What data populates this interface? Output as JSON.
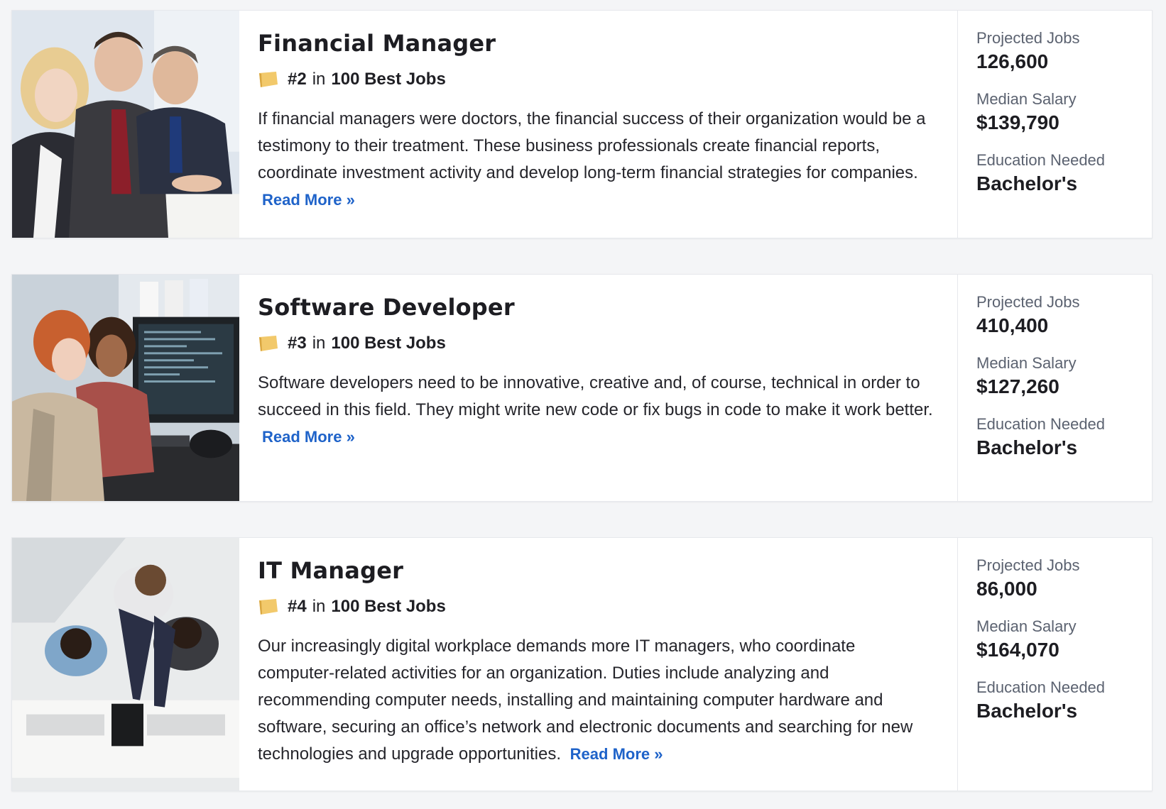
{
  "jobs": [
    {
      "title": "Financial Manager",
      "rank": "#2",
      "rank_in": "in",
      "rank_list": "100 Best Jobs",
      "description": "If financial managers were doctors, the financial success of their organization would be a testimony to their treatment. These business professionals create financial reports, coordinate investment activity and develop long-term financial strategies for companies.",
      "read_more": "Read More »",
      "stats": {
        "projected_jobs_label": "Projected Jobs",
        "projected_jobs": "126,600",
        "median_salary_label": "Median Salary",
        "median_salary": "$139,790",
        "education_label": "Education Needed",
        "education": "Bachelor's"
      }
    },
    {
      "title": "Software Developer",
      "rank": "#3",
      "rank_in": "in",
      "rank_list": "100 Best Jobs",
      "description": "Software developers need to be innovative, creative and, of course, technical in order to succeed in this field. They might write new code or fix bugs in code to make it work better.",
      "read_more": "Read More »",
      "stats": {
        "projected_jobs_label": "Projected Jobs",
        "projected_jobs": "410,400",
        "median_salary_label": "Median Salary",
        "median_salary": "$127,260",
        "education_label": "Education Needed",
        "education": "Bachelor's"
      }
    },
    {
      "title": "IT Manager",
      "rank": "#4",
      "rank_in": "in",
      "rank_list": "100 Best Jobs",
      "description": "Our increasingly digital workplace demands more IT managers, who coordinate computer-related activities for an organization. Duties include analyzing and recommending computer needs, installing and maintaining computer hardware and software, securing an office’s network and electronic documents and searching for new technologies and upgrade opportunities.",
      "read_more": "Read More »",
      "stats": {
        "projected_jobs_label": "Projected Jobs",
        "projected_jobs": "86,000",
        "median_salary_label": "Median Salary",
        "median_salary": "$164,070",
        "education_label": "Education Needed",
        "education": "Bachelor's"
      }
    }
  ],
  "colors": {
    "page_bg": "#f4f5f7",
    "link": "#1f63c9",
    "rank_icon": "#f2c96b",
    "label": "#5b6270"
  },
  "icons": {
    "rank": "ribbon-flag-icon"
  }
}
